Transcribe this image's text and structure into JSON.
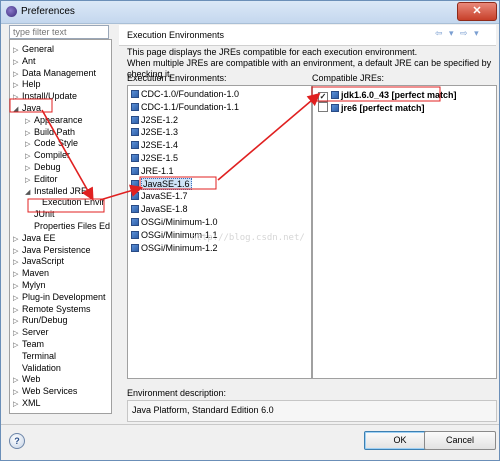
{
  "window": {
    "title": "Preferences",
    "close_glyph": "✕"
  },
  "filter": {
    "placeholder": "type filter text"
  },
  "tree": {
    "items": [
      {
        "label": "General",
        "twisty": "▷",
        "level": 0
      },
      {
        "label": "Ant",
        "twisty": "▷",
        "level": 0
      },
      {
        "label": "Data Management",
        "twisty": "▷",
        "level": 0
      },
      {
        "label": "Help",
        "twisty": "▷",
        "level": 0
      },
      {
        "label": "Install/Update",
        "twisty": "▷",
        "level": 0
      },
      {
        "label": "Java",
        "twisty": "◢",
        "level": 0
      },
      {
        "label": "Appearance",
        "twisty": "▷",
        "level": 1
      },
      {
        "label": "Build Path",
        "twisty": "▷",
        "level": 1
      },
      {
        "label": "Code Style",
        "twisty": "▷",
        "level": 1
      },
      {
        "label": "Compiler",
        "twisty": "▷",
        "level": 1
      },
      {
        "label": "Debug",
        "twisty": "▷",
        "level": 1
      },
      {
        "label": "Editor",
        "twisty": "▷",
        "level": 1
      },
      {
        "label": "Installed JREs",
        "twisty": "◢",
        "level": 1
      },
      {
        "label": "Execution Envir",
        "twisty": "",
        "level": 2
      },
      {
        "label": "JUnit",
        "twisty": "",
        "level": 1
      },
      {
        "label": "Properties Files Ed",
        "twisty": "",
        "level": 1
      },
      {
        "label": "Java EE",
        "twisty": "▷",
        "level": 0
      },
      {
        "label": "Java Persistence",
        "twisty": "▷",
        "level": 0
      },
      {
        "label": "JavaScript",
        "twisty": "▷",
        "level": 0
      },
      {
        "label": "Maven",
        "twisty": "▷",
        "level": 0
      },
      {
        "label": "Mylyn",
        "twisty": "▷",
        "level": 0
      },
      {
        "label": "Plug-in Development",
        "twisty": "▷",
        "level": 0
      },
      {
        "label": "Remote Systems",
        "twisty": "▷",
        "level": 0
      },
      {
        "label": "Run/Debug",
        "twisty": "▷",
        "level": 0
      },
      {
        "label": "Server",
        "twisty": "▷",
        "level": 0
      },
      {
        "label": "Team",
        "twisty": "▷",
        "level": 0
      },
      {
        "label": "Terminal",
        "twisty": "",
        "level": 0
      },
      {
        "label": "Validation",
        "twisty": "",
        "level": 0
      },
      {
        "label": "Web",
        "twisty": "▷",
        "level": 0
      },
      {
        "label": "Web Services",
        "twisty": "▷",
        "level": 0
      },
      {
        "label": "XML",
        "twisty": "▷",
        "level": 0
      }
    ]
  },
  "page": {
    "heading": "Execution Environments",
    "nav": "⇦ ▾ ⇨ ▾",
    "description_line1": "This page displays the JREs compatible for each execution environment.",
    "description_line2": "When multiple JREs are compatible with an environment, a default JRE can be specified by checking it.",
    "env_label": "Execution Environments:",
    "jre_label": "Compatible JREs:",
    "envdesc_label": "Environment description:",
    "envdesc_value": "Java Platform, Standard Edition 6.0"
  },
  "environments": [
    "CDC-1.0/Foundation-1.0",
    "CDC-1.1/Foundation-1.1",
    "J2SE-1.2",
    "J2SE-1.3",
    "J2SE-1.4",
    "J2SE-1.5",
    "JRE-1.1",
    "JavaSE-1.6",
    "JavaSE-1.7",
    "JavaSE-1.8",
    "OSGi/Minimum-1.0",
    "OSGi/Minimum-1.1",
    "OSGi/Minimum-1.2"
  ],
  "jres": [
    {
      "label": "jdk1.6.0_43 [perfect match]",
      "checked": true,
      "mark": "✓"
    },
    {
      "label": "jre6 [perfect match]",
      "checked": false,
      "mark": ""
    }
  ],
  "buttons": {
    "help": "?",
    "ok": "OK",
    "cancel": "Cancel"
  },
  "watermark": "http://blog.csdn.net/",
  "colors": {
    "annotation_red": "#e02020",
    "selection_blue": "#cfe3f7"
  }
}
